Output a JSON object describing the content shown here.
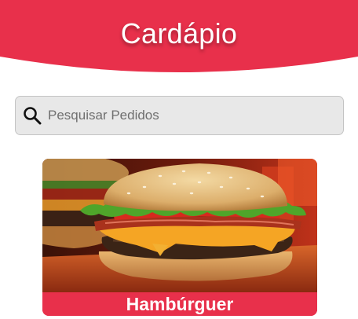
{
  "header": {
    "title": "Cardápio",
    "background_color": "#e8304b"
  },
  "search": {
    "icon": "search-icon",
    "placeholder": "Pesquisar Pedidos",
    "value": ""
  },
  "menu": {
    "items": [
      {
        "label": "Hambúrguer",
        "image": "hamburger-photo",
        "label_color": "#e8304b"
      }
    ]
  }
}
